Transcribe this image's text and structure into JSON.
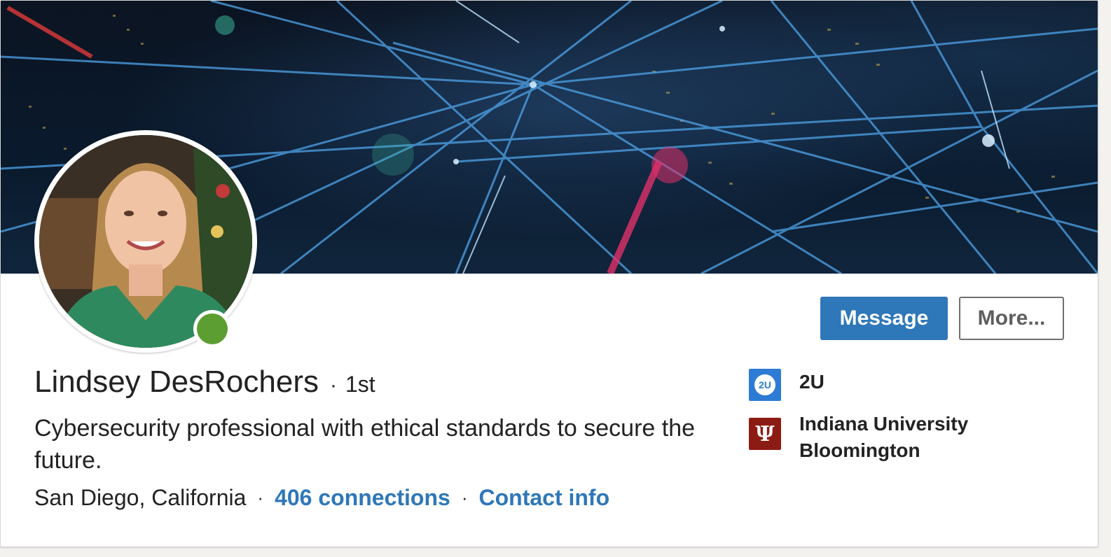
{
  "profile": {
    "name": "Lindsey DesRochers",
    "degree_separator": "·",
    "degree": "1st",
    "headline": "Cybersecurity professional with ethical standards to secure the future.",
    "location": "San Diego, California",
    "meta_separator": "·",
    "connections": "406 connections",
    "contact_info": "Contact info",
    "presence": "online"
  },
  "actions": {
    "message_label": "Message",
    "more_label": "More..."
  },
  "orgs": {
    "current_company": {
      "name": "2U",
      "logo_text": "2U",
      "logo_color": "#2d7bd4"
    },
    "education": {
      "name": "Indiana University Bloomington",
      "logo_text": "Ψ",
      "logo_color": "#8c1c13"
    }
  },
  "colors": {
    "accent": "#2e77b9",
    "presence_green": "#5c9e31"
  }
}
